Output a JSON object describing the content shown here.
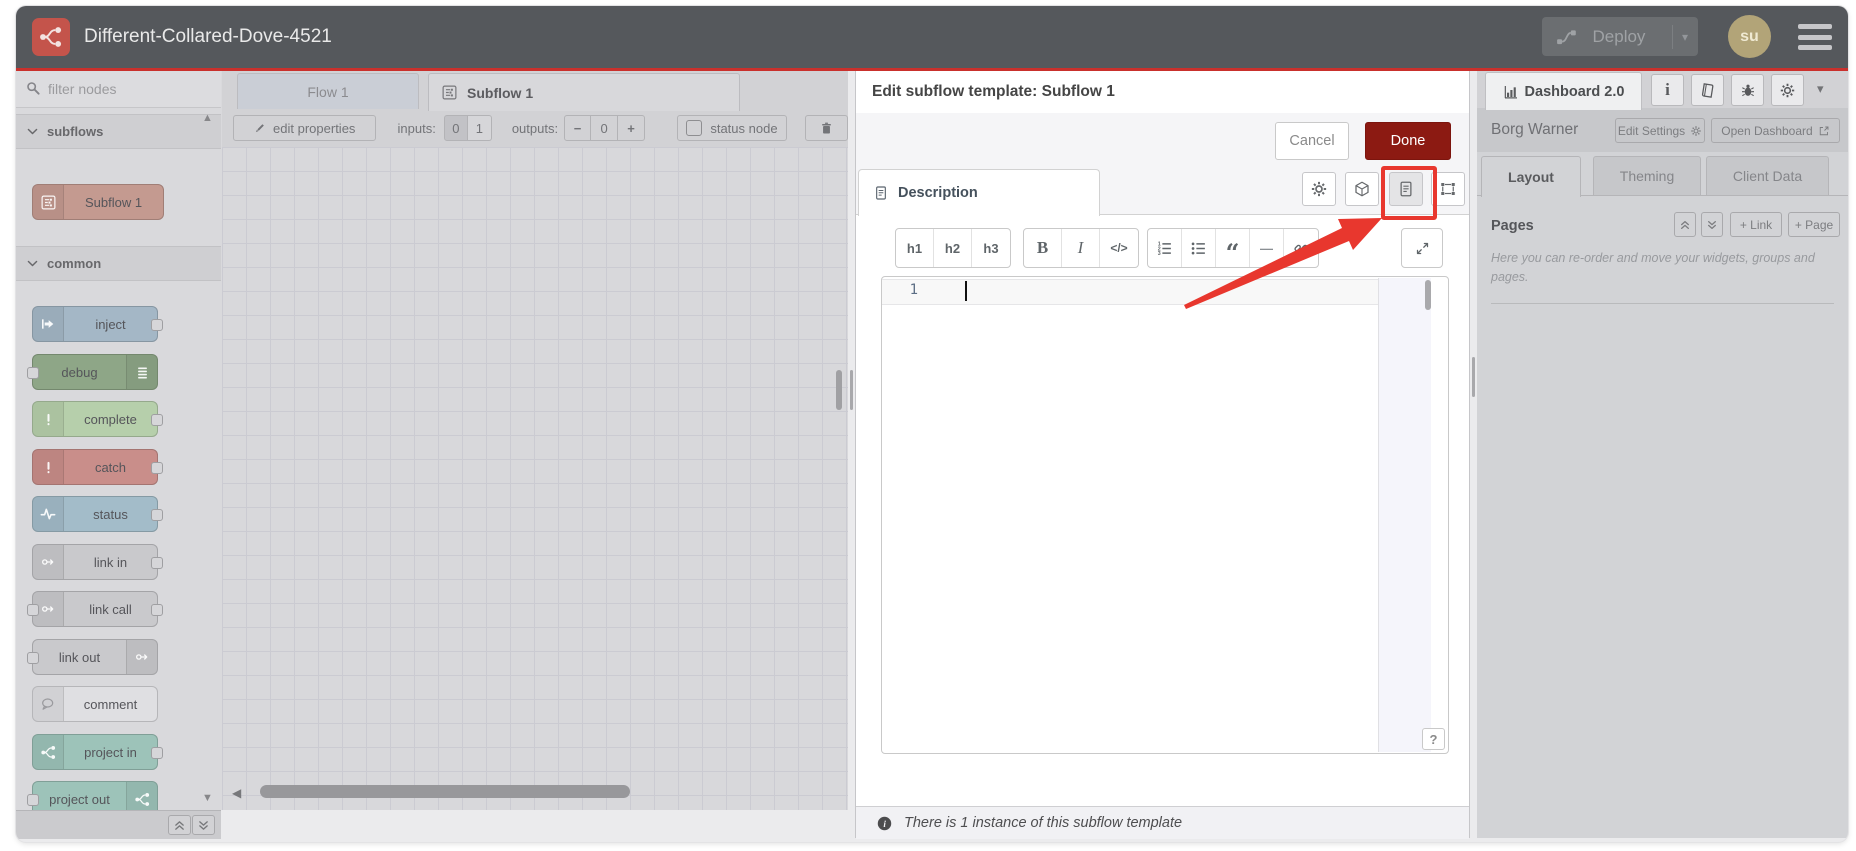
{
  "header": {
    "title": "Different-Collared-Dove-4521",
    "deploy_label": "Deploy",
    "avatar_initials": "su"
  },
  "palette": {
    "search_placeholder": "filter nodes",
    "categories": [
      {
        "label": "subflows"
      },
      {
        "label": "common"
      }
    ],
    "nodes": [
      {
        "label": "Subflow 1",
        "color": "#c49a90"
      },
      {
        "label": "inject",
        "color": "#a4b7c6"
      },
      {
        "label": "debug",
        "color": "#8ea687"
      },
      {
        "label": "complete",
        "color": "#b6cfab"
      },
      {
        "label": "catch",
        "color": "#c98e8a"
      },
      {
        "label": "status",
        "color": "#a3bcc9"
      },
      {
        "label": "link in",
        "color": "#c9c9cc"
      },
      {
        "label": "link call",
        "color": "#c9c9cc"
      },
      {
        "label": "link out",
        "color": "#c9c9cc"
      },
      {
        "label": "comment",
        "color": "#dfdfe2"
      },
      {
        "label": "project in",
        "color": "#9dc3b9"
      },
      {
        "label": "project out",
        "color": "#9dc3b9"
      }
    ]
  },
  "workspace": {
    "tabs": [
      {
        "label": "Flow 1"
      },
      {
        "label": "Subflow 1"
      }
    ],
    "toolbar": {
      "edit_properties": "edit properties",
      "inputs_label": "inputs:",
      "inputs_options": [
        "0",
        "1"
      ],
      "outputs_label": "outputs:",
      "minus": "−",
      "outputs_value": "0",
      "plus": "+",
      "status_node": "status node"
    }
  },
  "dialog": {
    "title": "Edit subflow template: Subflow 1",
    "cancel": "Cancel",
    "done": "Done",
    "tab": "Description",
    "toolbar": {
      "h1": "h1",
      "h2": "h2",
      "h3": "h3",
      "bold": "B",
      "italic": "I",
      "code": "</>",
      "quote": "“",
      "hr": "—"
    },
    "editor": {
      "line_number": "1",
      "help": "?"
    },
    "footer": "There is 1 instance of this subflow template"
  },
  "sidebar": {
    "tab": "Dashboard 2.0",
    "project": "Borg Warner",
    "edit_settings": "Edit Settings",
    "open_dashboard": "Open Dashboard",
    "tabs": [
      {
        "label": "Layout"
      },
      {
        "label": "Theming"
      },
      {
        "label": "Client Data"
      }
    ],
    "pages_title": "Pages",
    "link_button": "+ Link",
    "page_button": "+ Page",
    "hint": "Here you can re-order and move your widgets, groups and pages."
  },
  "colors": {
    "header_underline": "#c9302c",
    "done_button": "#8c1a12",
    "annotation_red": "#e8372e",
    "header_bg": "#55585c"
  }
}
